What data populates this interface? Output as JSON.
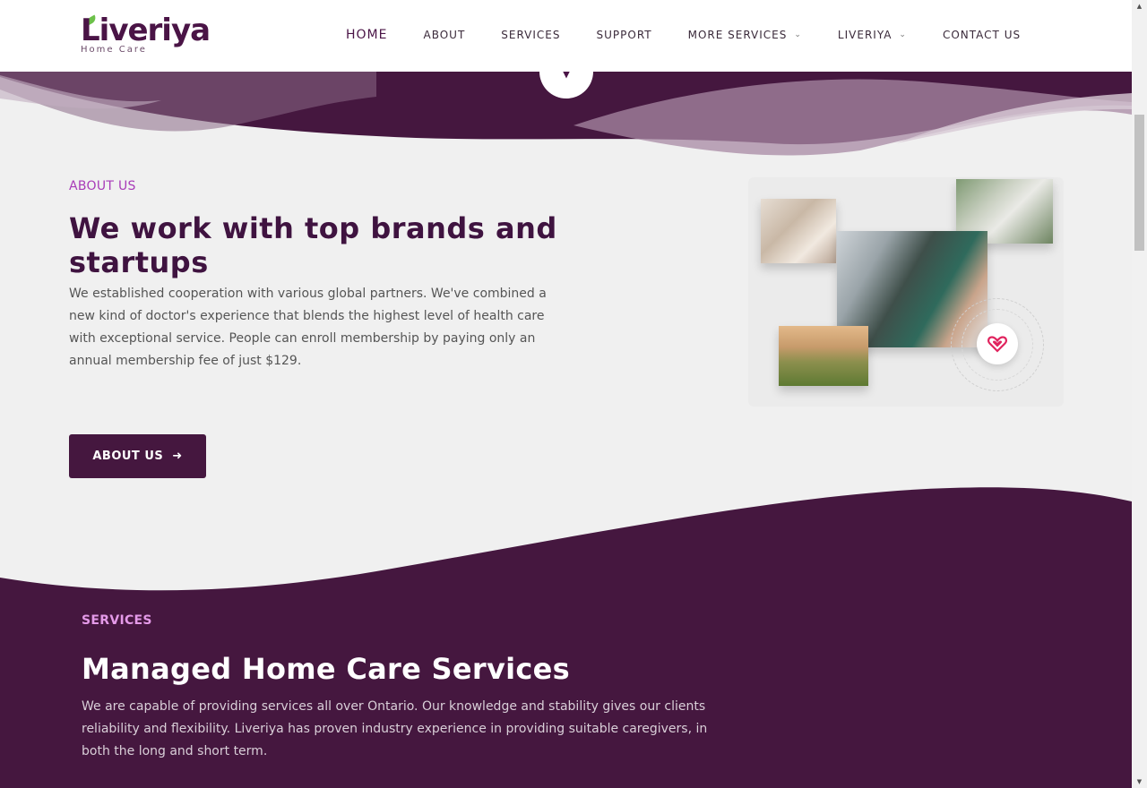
{
  "header": {
    "logo": {
      "word": "Liveriya",
      "tagline": "Home Care"
    },
    "nav": [
      {
        "label": "HOME",
        "active": true,
        "dropdown": false
      },
      {
        "label": "ABOUT",
        "active": false,
        "dropdown": false
      },
      {
        "label": "SERVICES",
        "active": false,
        "dropdown": false
      },
      {
        "label": "SUPPORT",
        "active": false,
        "dropdown": false
      },
      {
        "label": "MORE SERVICES",
        "active": false,
        "dropdown": true
      },
      {
        "label": "LIVERIYA",
        "active": false,
        "dropdown": true
      },
      {
        "label": "CONTACT US",
        "active": false,
        "dropdown": false
      }
    ]
  },
  "about": {
    "eyebrow": "ABOUT US",
    "title": "We work with top brands and startups",
    "text": "We established cooperation with various global partners. We've combined a new kind of doctor's experience that blends the highest level of health care with exceptional service. People can enroll membership by paying only an annual membership fee of just $129.",
    "button_label": "ABOUT US"
  },
  "services": {
    "eyebrow": "SERVICES",
    "title": "Managed Home Care Services",
    "text": "We are capable of providing services all over Ontario. Our knowledge and stability gives our clients reliability and flexibility. Liveriya has proven industry experience in providing suitable caregivers, in both the long and short term."
  },
  "icons": {
    "scroll_down": "chevron-down-icon",
    "button_arrow": "arrow-right-icon",
    "heart": "heart-icon",
    "nav_dropdown": "chevron-down-icon"
  },
  "colors": {
    "brand_purple": "#45173f",
    "accent_pink": "#a83bb8",
    "services_eyebrow": "#e49ae8",
    "heart_red": "#e0245e",
    "logo_leaf": "#6cc04a"
  }
}
